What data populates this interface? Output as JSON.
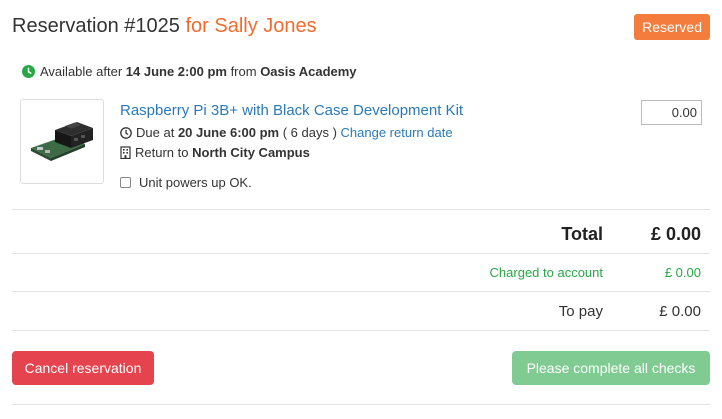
{
  "header": {
    "title_prefix": "Reservation #1025",
    "title_customer": "for Sally Jones",
    "status": "Reserved"
  },
  "availability": {
    "prefix": "Available after",
    "datetime": "14 June 2:00 pm",
    "from_word": "from",
    "location": "Oasis Academy"
  },
  "item": {
    "name": "Raspberry Pi 3B+ with Black Case Development Kit",
    "due_prefix": "Due at",
    "due_datetime": "20 June 6:00 pm",
    "duration": "( 6 days )",
    "change_link": "Change return date",
    "return_prefix": "Return to",
    "return_location": "North City Campus",
    "check_label": "Unit powers up OK.",
    "check_checked": false,
    "price_value": "0.00"
  },
  "summary": {
    "total_label": "Total",
    "total_value": "£ 0.00",
    "charged_label": "Charged to account",
    "charged_value": "£ 0.00",
    "topay_label": "To pay",
    "topay_value": "£ 0.00"
  },
  "actions": {
    "cancel_label": "Cancel reservation",
    "complete_label": "Please complete all checks"
  },
  "colors": {
    "customer": "#f26c2e",
    "badge": "#f47c3c",
    "link": "#2a7ab8",
    "success": "#28a745",
    "danger": "#e5434e",
    "disabled_success": "#7fcb92"
  },
  "icons": {
    "availability": "check-circle-icon",
    "due": "clock-icon",
    "return": "building-icon"
  }
}
